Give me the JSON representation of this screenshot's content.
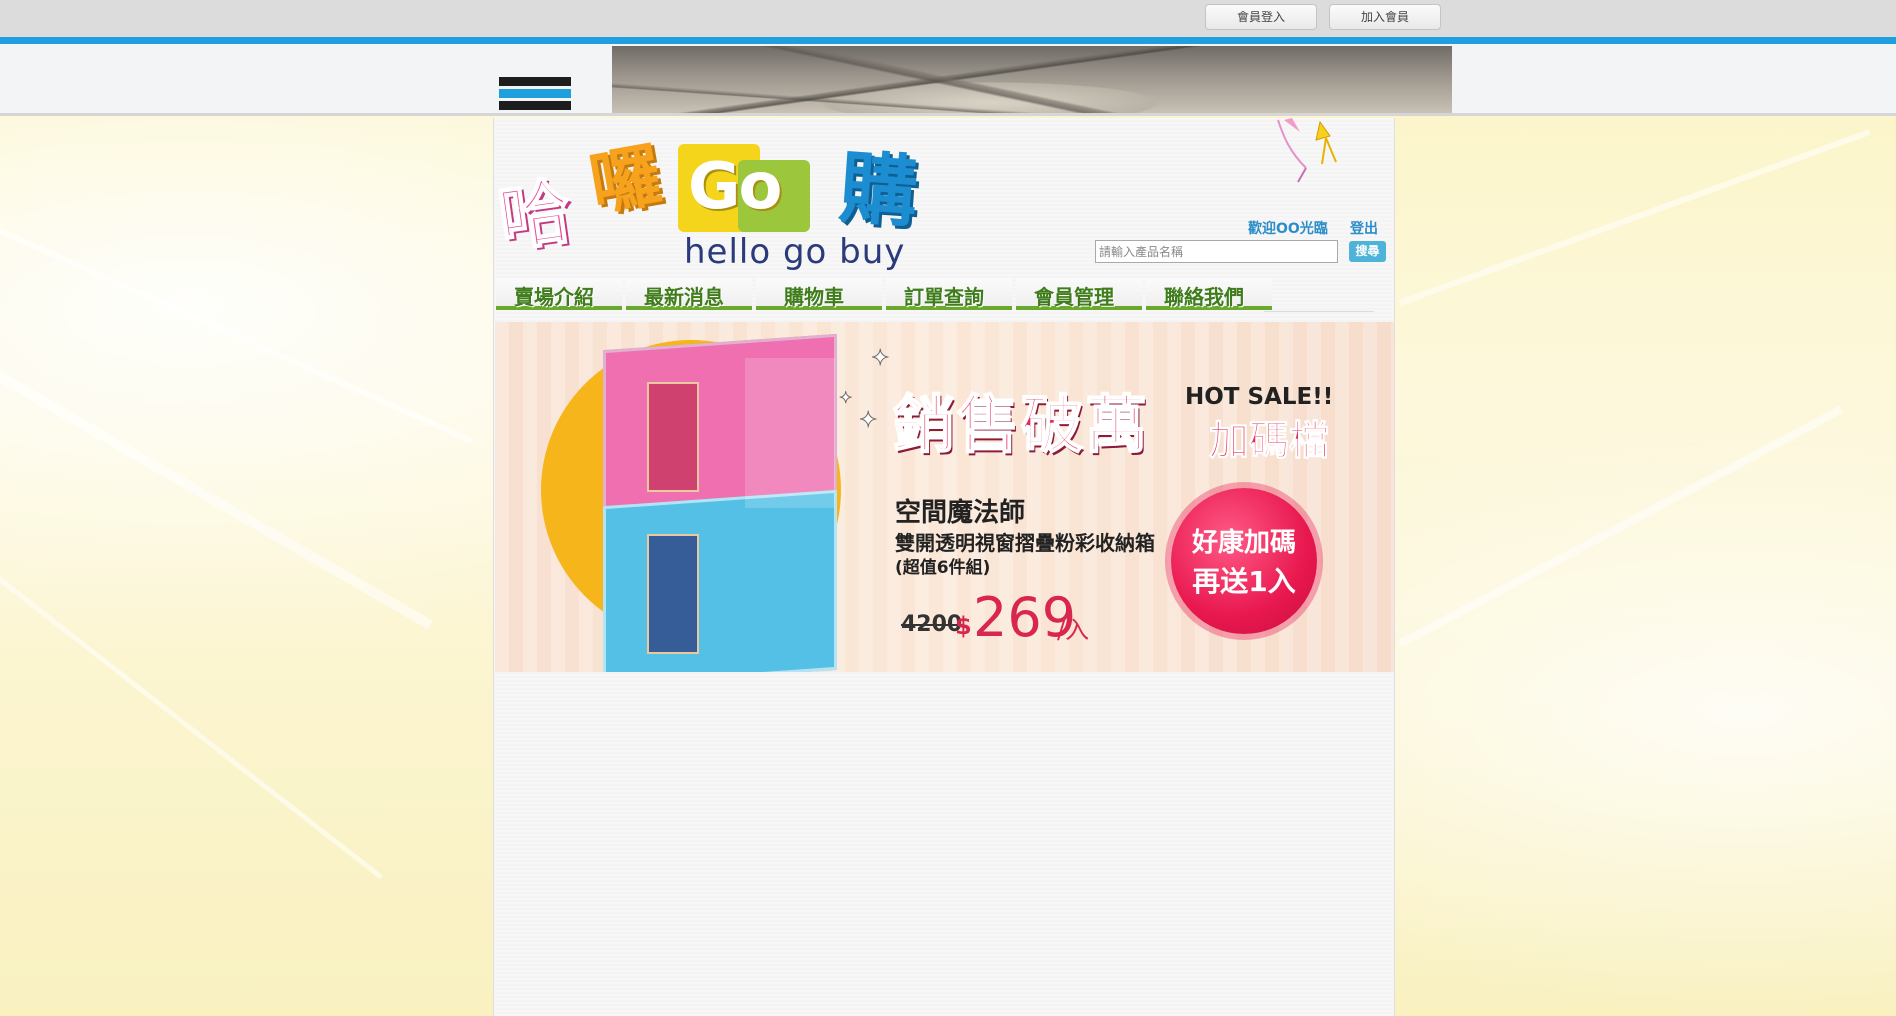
{
  "top_bar": {
    "login_label": "會員登入",
    "join_label": "加入會員"
  },
  "logo": {
    "char1": "哈",
    "char2": "囉",
    "go": "Go",
    "char3": "購",
    "subtitle": "hello go buy"
  },
  "user": {
    "welcome_text": "歡迎OO光臨",
    "logout_label": "登出"
  },
  "search": {
    "placeholder": "請輸入產品名稱",
    "button_label": "搜尋"
  },
  "nav": {
    "items": [
      {
        "label": "賣場介紹"
      },
      {
        "label": "最新消息"
      },
      {
        "label": "購物車"
      },
      {
        "label": "訂單查詢"
      },
      {
        "label": "會員管理"
      },
      {
        "label": "聯絡我們"
      }
    ]
  },
  "banner": {
    "headline": "銷售破萬",
    "headline_suffix": "加碼檔",
    "hot_sale": "HOT SALE!!",
    "product_name": "空間魔法師",
    "product_desc": "雙開透明視窗摺疊粉彩收納箱",
    "product_note": "(超值6件組)",
    "old_price": "4200",
    "currency": "$",
    "price": "269",
    "unit": "/入",
    "badge_line1": "好康加碼",
    "badge_line2": "再送1入"
  },
  "colors": {
    "accent_blue": "#1f9ee0",
    "nav_green": "#6ba92e",
    "banner_red": "#e12a5c"
  }
}
